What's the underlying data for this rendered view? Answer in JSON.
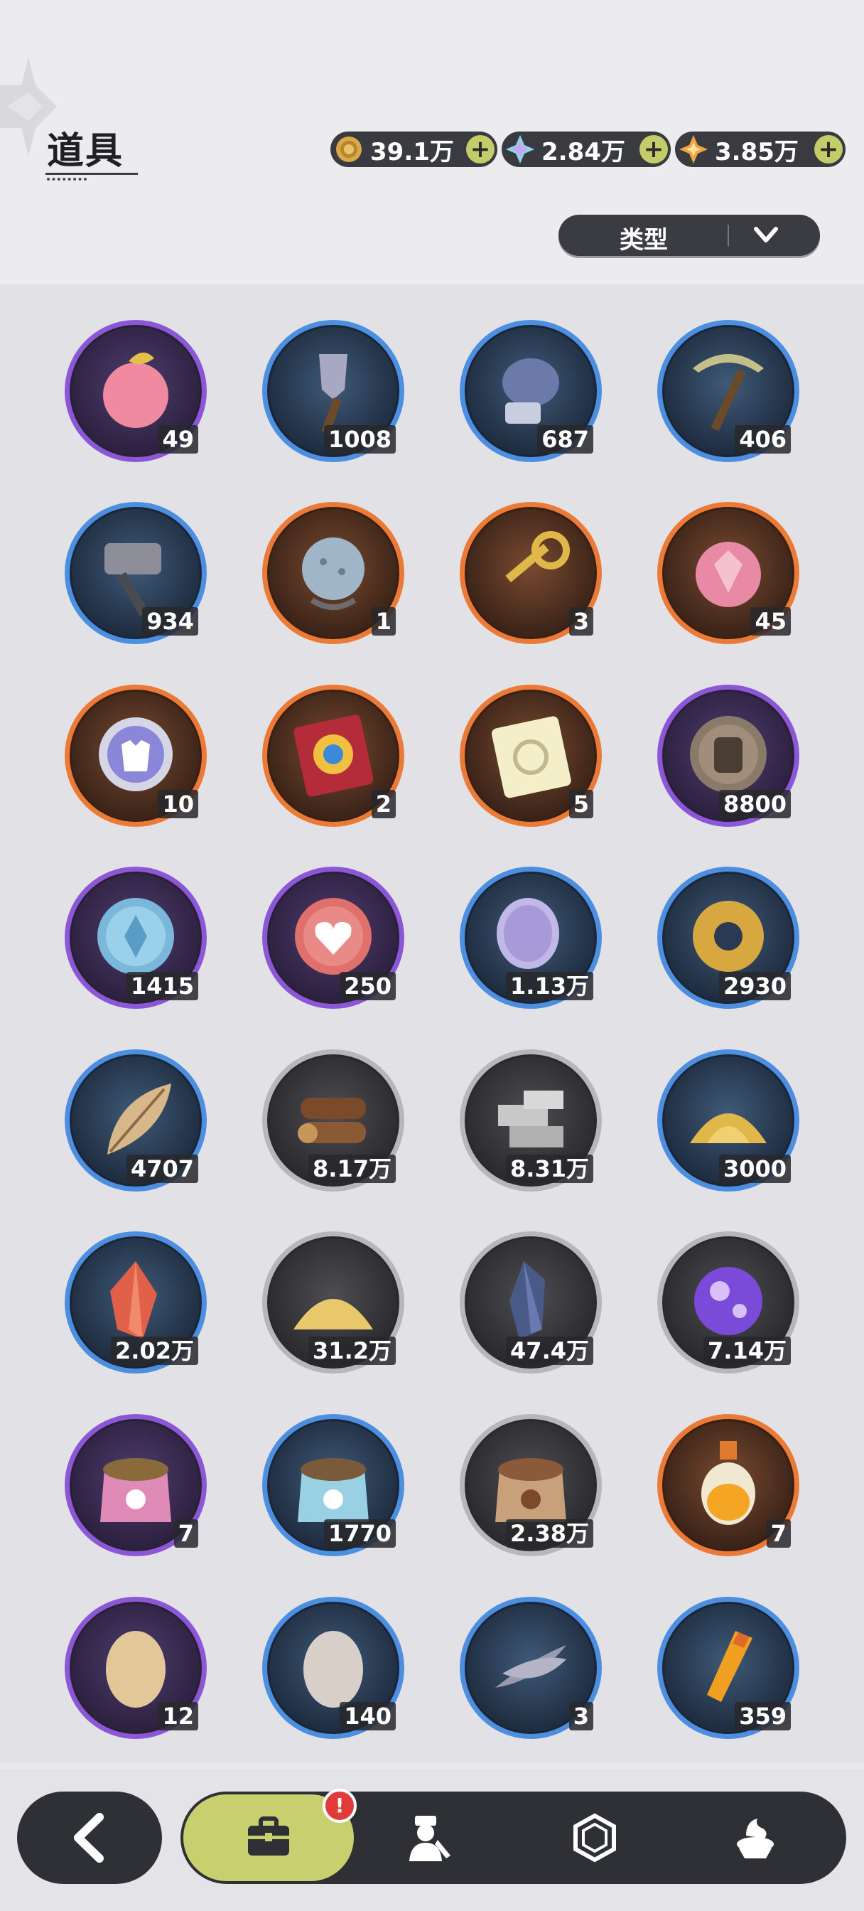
{
  "header": {
    "title": "道具",
    "currencies": [
      {
        "icon": "gold-coin-icon",
        "value": "39.1万"
      },
      {
        "icon": "crystal-gem-icon",
        "value": "2.84万"
      },
      {
        "icon": "star-gem-icon",
        "value": "3.85万"
      }
    ],
    "filter_label": "类型"
  },
  "items": [
    {
      "name": "peach-fruit",
      "rarity": "purple",
      "count": "49"
    },
    {
      "name": "shovel",
      "rarity": "blue",
      "count": "1008"
    },
    {
      "name": "gauntlet",
      "rarity": "blue",
      "count": "687"
    },
    {
      "name": "pickaxe",
      "rarity": "blue",
      "count": "406"
    },
    {
      "name": "hammer",
      "rarity": "blue",
      "count": "934"
    },
    {
      "name": "spiked-ball",
      "rarity": "orange",
      "count": "1"
    },
    {
      "name": "golden-key",
      "rarity": "orange",
      "count": "3"
    },
    {
      "name": "crystal-fruit",
      "rarity": "orange",
      "count": "45"
    },
    {
      "name": "outfit-coin",
      "rarity": "orange",
      "count": "10"
    },
    {
      "name": "wheel-ticket",
      "rarity": "orange",
      "count": "2"
    },
    {
      "name": "rainbow-ticket",
      "rarity": "orange",
      "count": "5"
    },
    {
      "name": "fist-medal",
      "rarity": "purple",
      "count": "8800"
    },
    {
      "name": "blue-medal",
      "rarity": "purple",
      "count": "1415"
    },
    {
      "name": "heart-medal",
      "rarity": "purple",
      "count": "250"
    },
    {
      "name": "scale-stone",
      "rarity": "blue",
      "count": "1.13万"
    },
    {
      "name": "gear",
      "rarity": "blue",
      "count": "2930"
    },
    {
      "name": "leaf",
      "rarity": "blue",
      "count": "4707"
    },
    {
      "name": "wood-logs",
      "rarity": "gray",
      "count": "8.17万"
    },
    {
      "name": "stone-bricks",
      "rarity": "gray",
      "count": "8.31万"
    },
    {
      "name": "gold-sand",
      "rarity": "blue",
      "count": "3000"
    },
    {
      "name": "red-crystal",
      "rarity": "blue",
      "count": "2.02万"
    },
    {
      "name": "yellow-sand",
      "rarity": "gray",
      "count": "31.2万"
    },
    {
      "name": "dark-crystal",
      "rarity": "gray",
      "count": "47.4万"
    },
    {
      "name": "purple-orb",
      "rarity": "gray",
      "count": "7.14万"
    },
    {
      "name": "pink-pet-food",
      "rarity": "purple",
      "count": "7"
    },
    {
      "name": "blue-pet-food",
      "rarity": "blue",
      "count": "1770"
    },
    {
      "name": "brown-pet-food",
      "rarity": "gray",
      "count": "2.38万"
    },
    {
      "name": "potion-bottle",
      "rarity": "orange",
      "count": "7"
    },
    {
      "name": "tan-egg",
      "rarity": "purple",
      "count": "12"
    },
    {
      "name": "white-egg",
      "rarity": "blue",
      "count": "140"
    },
    {
      "name": "feathers",
      "rarity": "blue",
      "count": "3"
    },
    {
      "name": "orange-vial",
      "rarity": "blue",
      "count": "359"
    }
  ],
  "nav": {
    "badge": "!",
    "tabs": [
      "bag-icon",
      "character-icon",
      "hexagon-icon",
      "dessert-icon"
    ]
  }
}
